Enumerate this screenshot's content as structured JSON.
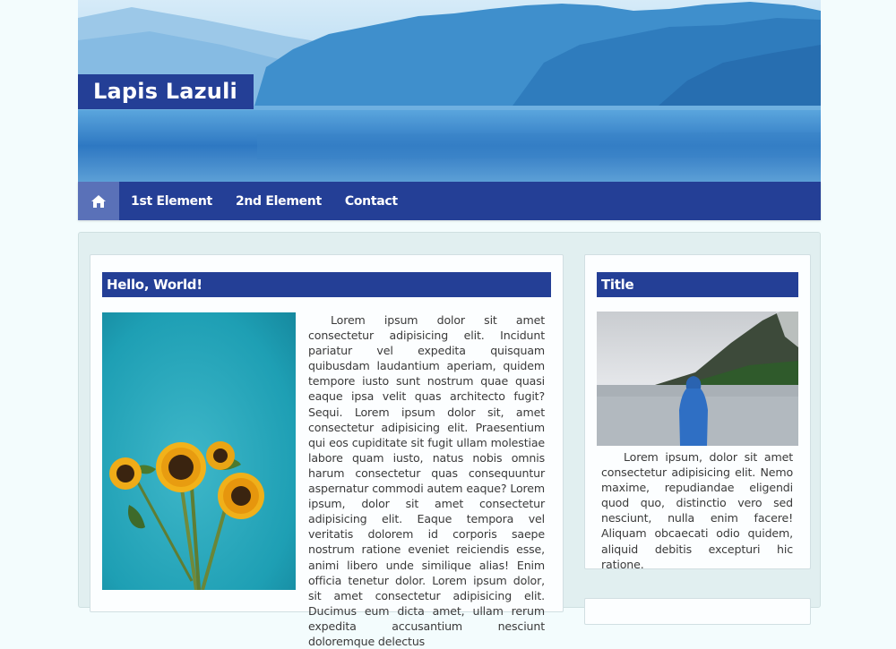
{
  "site": {
    "title": "Lapis Lazuli"
  },
  "nav": {
    "home_icon": "home-icon",
    "items": [
      {
        "label": "1st Element"
      },
      {
        "label": "2nd Element"
      },
      {
        "label": "Contact"
      }
    ]
  },
  "main_card": {
    "title": "Hello, World!",
    "image": "sunflowers-photo",
    "body": "Lorem ipsum dolor sit amet consectetur adipisicing elit. Incidunt pariatur vel expedita quisquam quibusdam laudantium aperiam, quidem tempore iusto sunt nostrum quae quasi eaque ipsa velit quas architecto fugit? Sequi. Lorem ipsum dolor sit, amet consectetur adipisicing elit. Praesentium qui eos cupiditate sit fugit ullam molestiae labore quam iusto, natus nobis omnis harum consectetur quas consequuntur aspernatur commodi autem eaque? Lorem ipsum, dolor sit amet consectetur adipisicing elit. Eaque tempora vel veritatis dolorem id corporis saepe nostrum ratione eveniet reiciendis esse, animi libero unde similique alias! Enim officia tenetur dolor. Lorem ipsum dolor, sit amet consectetur adipisicing elit. Ducimus eum dicta amet, ullam rerum expedita accusantium nesciunt doloremque delectus"
  },
  "side_card": {
    "title": "Title",
    "image": "lake-hooded-person-photo",
    "body": "Lorem ipsum, dolor sit amet consectetur adipisicing elit. Nemo maxime, repudiandae eligendi quod quo, distinctio vero sed nesciunt, nulla enim facere! Aliquam obcaecati odio quidem, aliquid debitis excepturi hic ratione."
  },
  "colors": {
    "accent": "#243f96",
    "home_active": "#5a71b8",
    "page_bg": "#f3fcfd",
    "main_bg": "#e1eff0"
  }
}
